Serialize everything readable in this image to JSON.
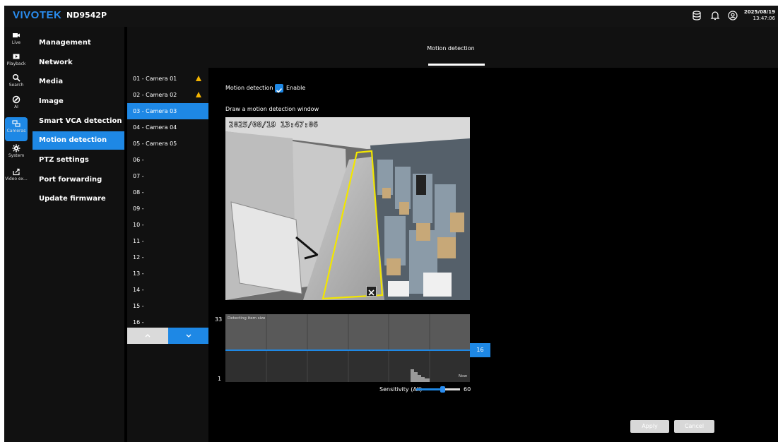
{
  "header": {
    "brand": "VIVOTEK",
    "model": "ND9542P",
    "date": "2025/08/19",
    "time": "13:47:06",
    "icons": [
      "database-icon",
      "bell-icon",
      "user-icon"
    ]
  },
  "rail": {
    "items": [
      {
        "label": "Live",
        "icon": "camera-icon"
      },
      {
        "label": "Playback",
        "icon": "play-icon"
      },
      {
        "label": "Search",
        "icon": "search-icon"
      },
      {
        "label": "AI",
        "icon": "ai-icon"
      },
      {
        "label": "Cameras",
        "icon": "cameras-icon",
        "active": true
      },
      {
        "label": "System",
        "icon": "gear-icon"
      },
      {
        "label": "Video ex...",
        "icon": "export-icon"
      }
    ]
  },
  "menu": {
    "items": [
      {
        "label": "Management"
      },
      {
        "label": "Network"
      },
      {
        "label": "Media"
      },
      {
        "label": "Image"
      },
      {
        "label": "Smart VCA detection"
      },
      {
        "label": "Motion detection",
        "active": true
      },
      {
        "label": "PTZ settings"
      },
      {
        "label": "Port forwarding"
      },
      {
        "label": "Update firmware"
      }
    ]
  },
  "cameras": {
    "items": [
      {
        "label": "01 - Camera 01",
        "warning": true
      },
      {
        "label": "02 - Camera 02",
        "warning": true
      },
      {
        "label": "03 - Camera 03",
        "active": true
      },
      {
        "label": "04 - Camera 04"
      },
      {
        "label": "05 - Camera 05"
      },
      {
        "label": "06 -"
      },
      {
        "label": "07 -"
      },
      {
        "label": "08 -"
      },
      {
        "label": "09 -"
      },
      {
        "label": "10 -"
      },
      {
        "label": "11 -"
      },
      {
        "label": "12 -"
      },
      {
        "label": "13 -"
      },
      {
        "label": "14 -"
      },
      {
        "label": "15 -"
      },
      {
        "label": "16 -"
      }
    ],
    "pager": {
      "up_icon": "chevron-up-icon",
      "down_icon": "chevron-down-icon"
    }
  },
  "tab": {
    "label": "Motion detection"
  },
  "main": {
    "motion_label": "Motion detection",
    "enable_label": "Enable",
    "enable_checked": true,
    "draw_label": "Draw a motion detection window",
    "video_timestamp": "2025/08/19 13:47:06",
    "window_close_icon": "close-icon"
  },
  "detect_chart": {
    "title": "Detecting item size",
    "y_max": "33",
    "y_min": "1",
    "threshold": "16",
    "now_label": "Now"
  },
  "sensitivity": {
    "label": "Sensitivity (All)",
    "value": "60",
    "fraction": 0.6
  },
  "buttons": {
    "apply": "Apply",
    "cancel": "Cancel"
  },
  "colors": {
    "accent": "#1e88e5",
    "warning": "#f4b400",
    "motion_window": "#f2e600"
  }
}
